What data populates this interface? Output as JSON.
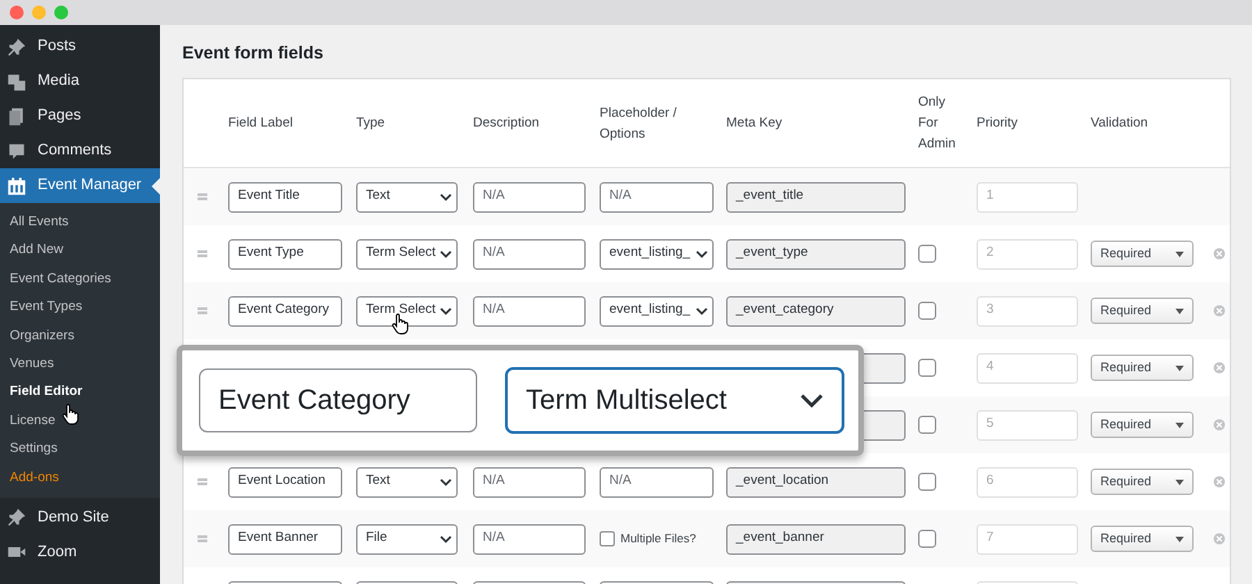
{
  "sidebar": {
    "items": [
      {
        "label": "Posts",
        "selected": false
      },
      {
        "label": "Media",
        "selected": false
      },
      {
        "label": "Pages",
        "selected": false
      },
      {
        "label": "Comments",
        "selected": false
      },
      {
        "label": "Event Manager",
        "selected": true,
        "children": [
          {
            "label": "All Events",
            "selected": false,
            "kind": "normal"
          },
          {
            "label": "Add New",
            "selected": false,
            "kind": "normal"
          },
          {
            "label": "Event Categories",
            "selected": false,
            "kind": "normal"
          },
          {
            "label": "Event Types",
            "selected": false,
            "kind": "normal"
          },
          {
            "label": "Organizers",
            "selected": false,
            "kind": "normal"
          },
          {
            "label": "Venues",
            "selected": false,
            "kind": "normal"
          },
          {
            "label": "Field Editor",
            "selected": true,
            "kind": "normal"
          },
          {
            "label": "License",
            "selected": false,
            "kind": "normal"
          },
          {
            "label": "Settings",
            "selected": false,
            "kind": "normal"
          },
          {
            "label": "Add-ons",
            "selected": false,
            "kind": "highlight"
          }
        ]
      },
      {
        "label": "Demo Site",
        "selected": false
      },
      {
        "label": "Zoom",
        "selected": false
      }
    ]
  },
  "page_title": "Event form fields",
  "table": {
    "columns": [
      "Field Label",
      "Type",
      "Description",
      "Placeholder / Options",
      "Meta Key",
      "Only For Admin",
      "Priority",
      "Validation"
    ],
    "rows": [
      {
        "label": "Event Title",
        "type": "Text",
        "description": "N/A",
        "placeholder": {
          "kind": "text",
          "value": "N/A"
        },
        "meta_key": "_event_title",
        "priority": "1"
      },
      {
        "label": "Event Type",
        "type": "Term Select",
        "description": "N/A",
        "placeholder": {
          "kind": "select",
          "value": "event_listing_"
        },
        "meta_key": "_event_type",
        "admin_only": false,
        "priority": "2",
        "validation": "Required"
      },
      {
        "label": "Event Category",
        "type": "Term Select",
        "description": "N/A",
        "placeholder": {
          "kind": "select",
          "value": "event_listing_"
        },
        "meta_key": "_event_category",
        "admin_only": false,
        "priority": "3",
        "validation": "Required"
      },
      {
        "admin_only": false,
        "priority": "4",
        "validation": "Required"
      },
      {
        "admin_only": false,
        "priority": "5",
        "validation": "Required"
      },
      {
        "label": "Event Location",
        "type": "Text",
        "description": "N/A",
        "placeholder": {
          "kind": "text",
          "value": "N/A"
        },
        "meta_key": "_event_location",
        "admin_only": false,
        "priority": "6",
        "validation": "Required"
      },
      {
        "label": "Event Banner",
        "type": "File",
        "description": "N/A",
        "placeholder": {
          "kind": "checkbox",
          "value": "Multiple Files?",
          "checked": false
        },
        "meta_key": "_event_banner",
        "admin_only": false,
        "priority": "7",
        "validation": "Required"
      },
      {}
    ]
  },
  "zoom_callout": {
    "label": "Event Category",
    "type": "Term Multiselect"
  }
}
